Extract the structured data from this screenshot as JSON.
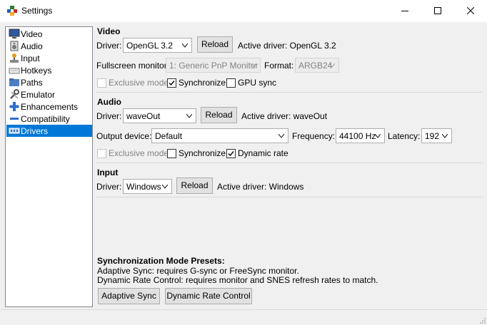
{
  "window": {
    "title": "Settings"
  },
  "sidebar": {
    "items": [
      {
        "label": "Video",
        "icon": "monitor-icon"
      },
      {
        "label": "Audio",
        "icon": "speaker-icon"
      },
      {
        "label": "Input",
        "icon": "joystick-icon"
      },
      {
        "label": "Hotkeys",
        "icon": "keyboard-icon"
      },
      {
        "label": "Paths",
        "icon": "folder-icon"
      },
      {
        "label": "Emulator",
        "icon": "wrench-icon"
      },
      {
        "label": "Enhancements",
        "icon": "plus-icon"
      },
      {
        "label": "Compatibility",
        "icon": "minus-icon"
      },
      {
        "label": "Drivers",
        "icon": "drivers-icon"
      }
    ],
    "selected": "Drivers"
  },
  "video": {
    "title": "Video",
    "driver_label": "Driver:",
    "driver_value": "OpenGL 3.2",
    "reload_label": "Reload",
    "active_driver": "Active driver: OpenGL 3.2",
    "fullscreen_label": "Fullscreen monitor:",
    "fullscreen_value": "1: Generic PnP Monitor",
    "format_label": "Format:",
    "format_value": "ARGB24",
    "exclusive_label": "Exclusive mode",
    "sync_label": "Synchronize",
    "gpu_sync_label": "GPU sync",
    "exclusive_checked": false,
    "sync_checked": true,
    "gpu_sync_checked": false
  },
  "audio": {
    "title": "Audio",
    "driver_label": "Driver:",
    "driver_value": "waveOut",
    "reload_label": "Reload",
    "active_driver": "Active driver: waveOut",
    "output_label": "Output device:",
    "output_value": "Default",
    "frequency_label": "Frequency:",
    "frequency_value": "44100 Hz",
    "latency_label": "Latency:",
    "latency_value": "192",
    "exclusive_label": "Exclusive mode",
    "sync_label": "Synchronize",
    "dynamic_label": "Dynamic rate",
    "exclusive_checked": false,
    "sync_checked": false,
    "dynamic_checked": true
  },
  "input": {
    "title": "Input",
    "driver_label": "Driver:",
    "driver_value": "Windows",
    "reload_label": "Reload",
    "active_driver": "Active driver: Windows"
  },
  "presets": {
    "title": "Synchronization Mode Presets:",
    "line1": "Adaptive Sync: requires G-sync or FreeSync monitor.",
    "line2": "Dynamic Rate Control: requires monitor and SNES refresh rates to match.",
    "adaptive_button": "Adaptive Sync",
    "dynamic_button": "Dynamic Rate Control"
  }
}
